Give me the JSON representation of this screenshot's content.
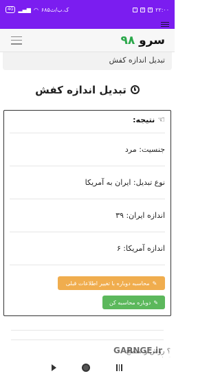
{
  "status_bar": {
    "time": "۲۲:۰۰",
    "network_speed": "۶۸۵ک.ب/ث",
    "left_badge": "4G",
    "icons": [
      "battery-icon",
      "volte-icon",
      "signal-icon",
      "signal-icon",
      "wifi-icon",
      "alarm-icon",
      "notification-icon",
      "app-icon",
      "app-icon"
    ]
  },
  "navbar": {
    "brand_text": "سرو",
    "brand_number": "۹۸"
  },
  "breadcrumb": {
    "text": "تبدیل اندازه کفش"
  },
  "page": {
    "title": "تبدیل اندازه کفش"
  },
  "result": {
    "heading": "نتیجه:",
    "rows": [
      "جنسیت: مرد",
      "نوع تبدیل: ایران به آمریکا",
      "اندازه ایران: ۳۹",
      "اندازه آمریکا: ۶"
    ]
  },
  "buttons": {
    "recalc_change": "محاسبه دوباره با تغییر اطلاعات قبلی",
    "recalc": "دوباره محاسبه کن"
  },
  "partial": {
    "text": "؟ روش و سطح ترخ"
  },
  "watermark": "GARNGE.ir",
  "colors": {
    "status_bar": "#7b1df0",
    "warning_button": "#f0ad4e",
    "success_button": "#5cb85c",
    "brand_number": "#2aa84a"
  }
}
